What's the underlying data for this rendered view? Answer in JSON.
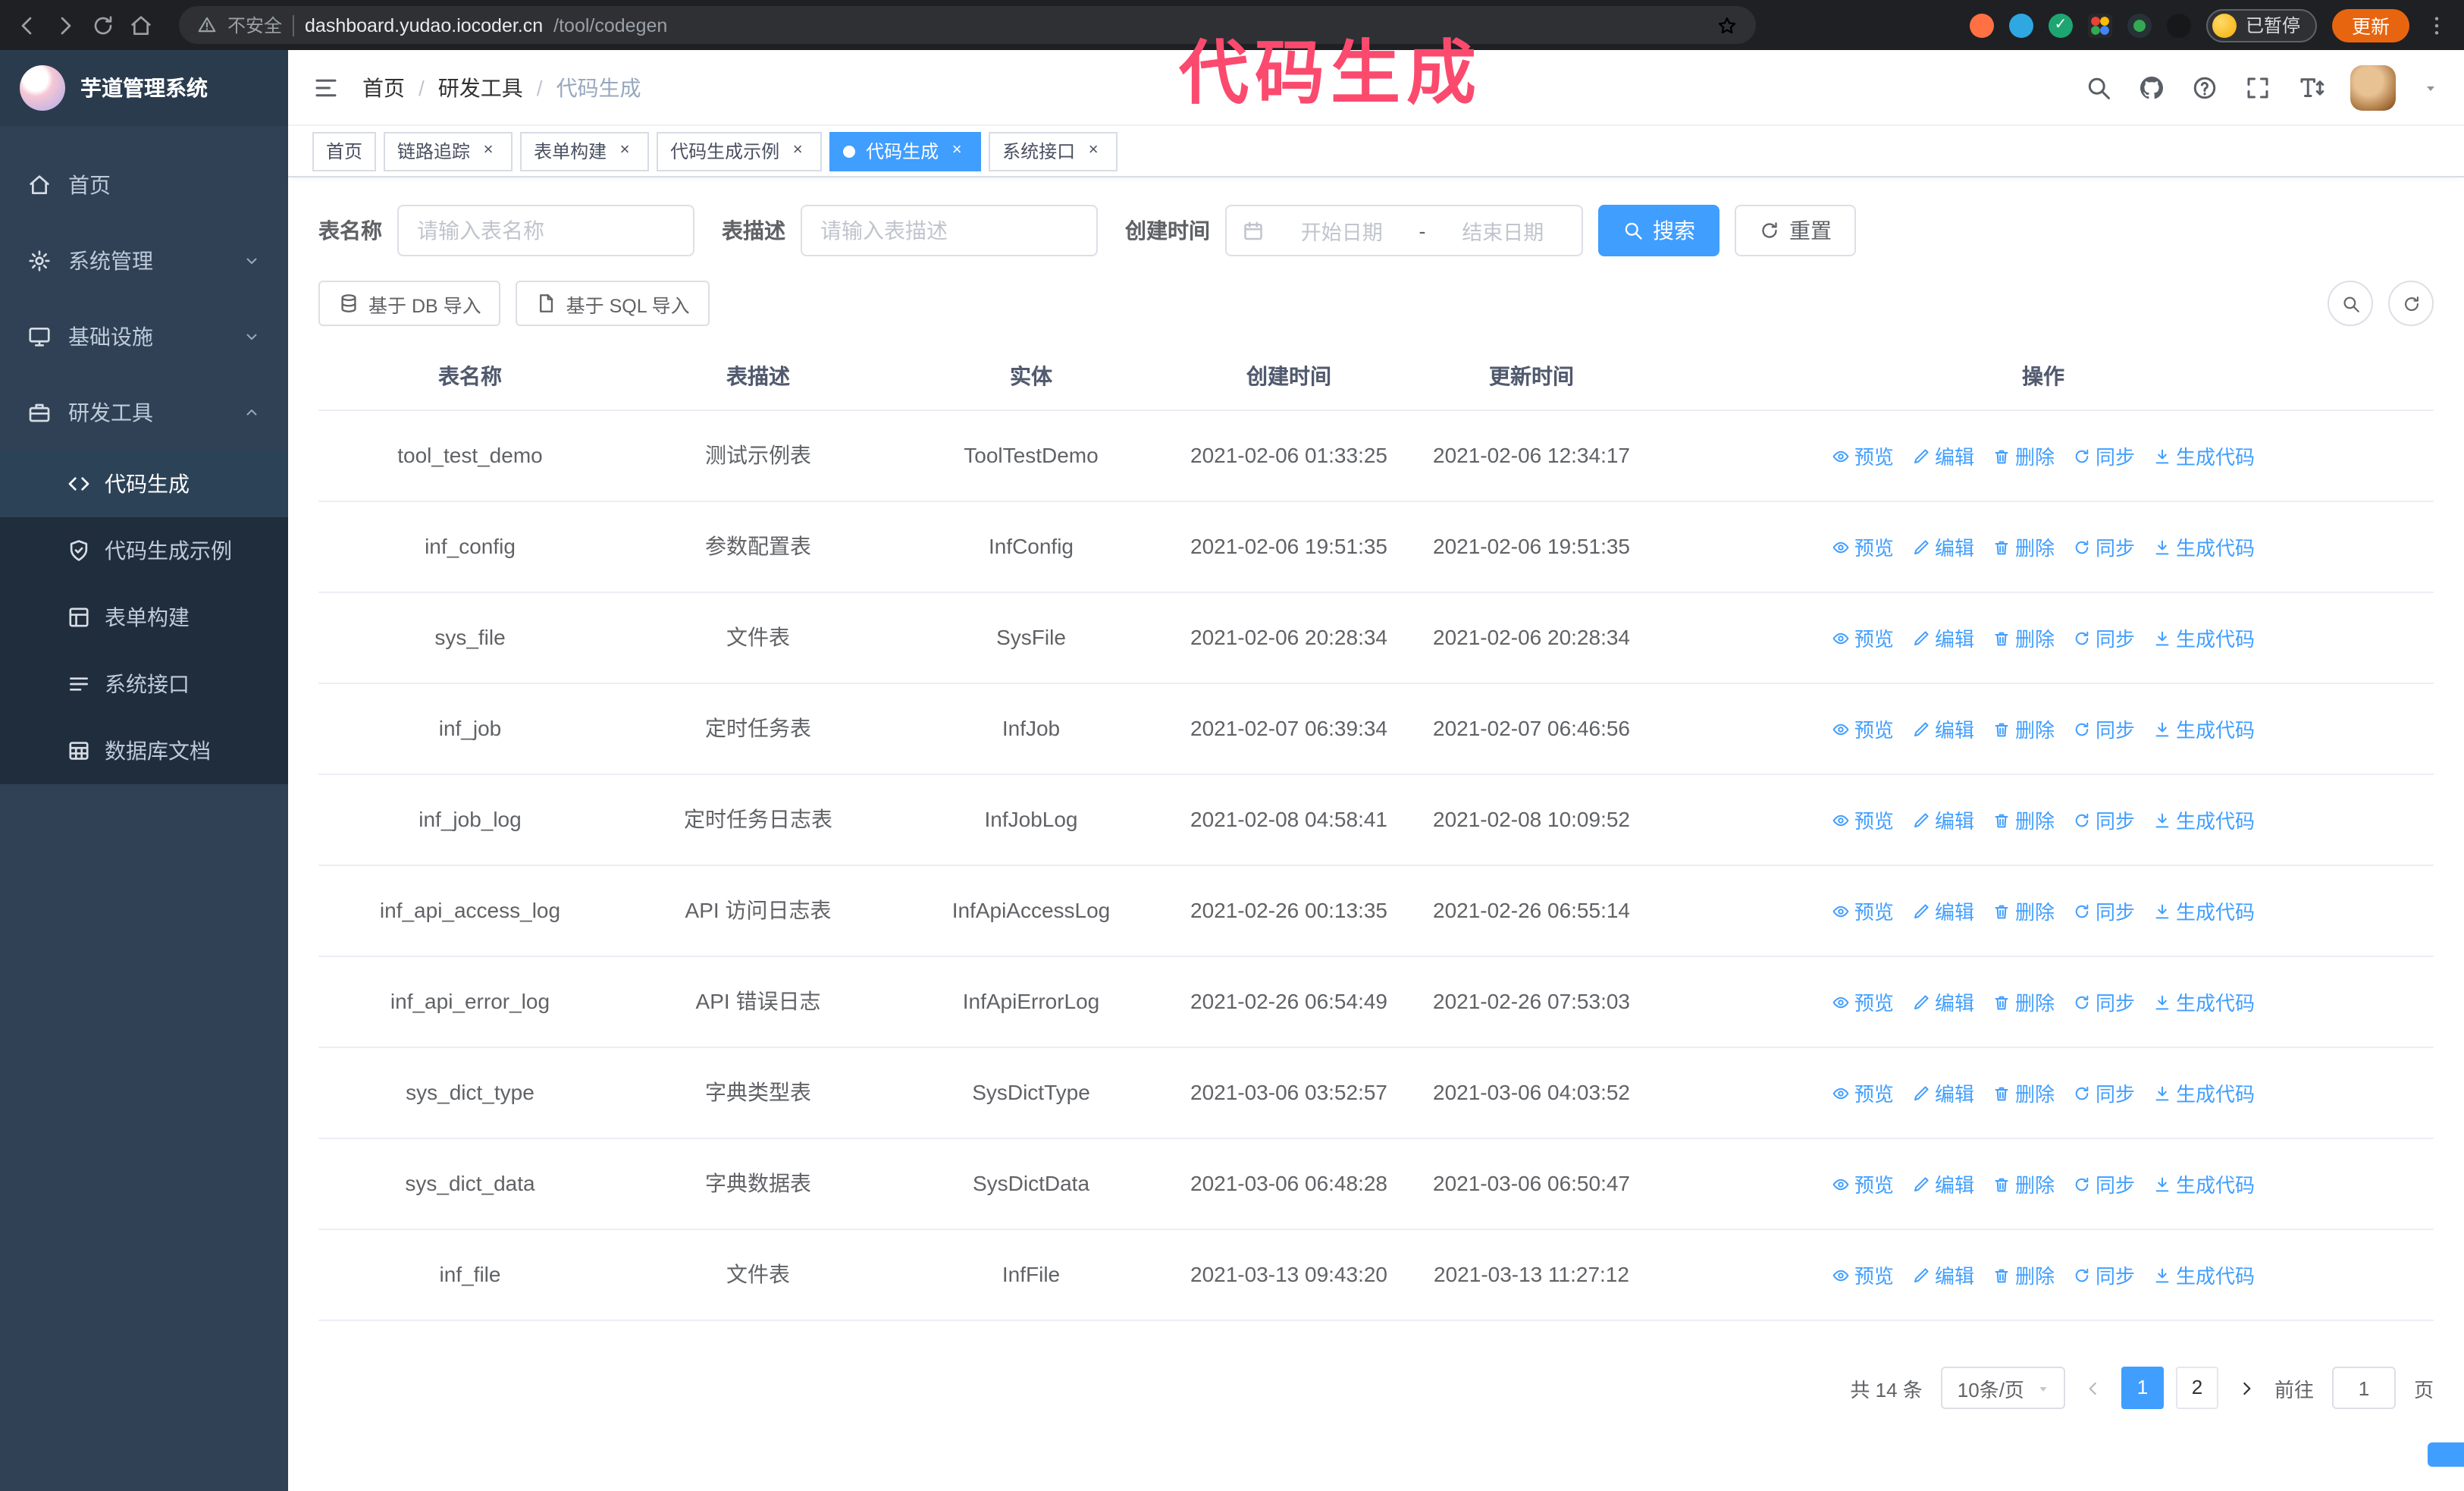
{
  "browser": {
    "security_warning": "不安全",
    "url_host": "dashboard.yudao.iocoder.cn",
    "url_path": "/tool/codegen",
    "paused_badge": "已暂停",
    "update_button": "更新"
  },
  "annotation": {
    "text": "代码生成",
    "color": "#fb4a6e"
  },
  "sidebar": {
    "logo_title": "芋道管理系统",
    "items": [
      {
        "label": "首页",
        "icon": "home5"
      },
      {
        "label": "系统管理",
        "icon": "gear",
        "expandable": true
      },
      {
        "label": "基础设施",
        "icon": "monitor",
        "expandable": true
      },
      {
        "label": "研发工具",
        "icon": "tools",
        "expandable": true,
        "expanded": true
      }
    ],
    "sub_items": [
      {
        "label": "代码生成",
        "icon": "code",
        "active": true
      },
      {
        "label": "代码生成示例",
        "icon": "shield"
      },
      {
        "label": "表单构建",
        "icon": "formgrid"
      },
      {
        "label": "系统接口",
        "icon": "api"
      },
      {
        "label": "数据库文档",
        "icon": "dbdoc"
      }
    ]
  },
  "header": {
    "breadcrumb": [
      "首页",
      "研发工具",
      "代码生成"
    ],
    "separator": "/"
  },
  "tabs": {
    "close_glyph": "×",
    "items": [
      {
        "label": "首页",
        "closable": false
      },
      {
        "label": "链路追踪",
        "closable": true
      },
      {
        "label": "表单构建",
        "closable": true
      },
      {
        "label": "代码生成示例",
        "closable": true
      },
      {
        "label": "代码生成",
        "closable": true,
        "active": true
      },
      {
        "label": "系统接口",
        "closable": true
      }
    ]
  },
  "filters": {
    "table_name_label": "表名称",
    "table_name_placeholder": "请输入表名称",
    "table_desc_label": "表描述",
    "table_desc_placeholder": "请输入表描述",
    "create_time_label": "创建时间",
    "date_start_placeholder": "开始日期",
    "date_separator": "-",
    "date_end_placeholder": "结束日期",
    "search_button": "搜索",
    "reset_button": "重置"
  },
  "toolbar": {
    "import_db": "基于 DB 导入",
    "import_sql": "基于 SQL 导入"
  },
  "table": {
    "columns": [
      "表名称",
      "表描述",
      "实体",
      "创建时间",
      "更新时间",
      "操作"
    ],
    "actions": [
      {
        "key": "preview",
        "label": "预览",
        "icon": "eye"
      },
      {
        "key": "edit",
        "label": "编辑",
        "icon": "edit"
      },
      {
        "key": "delete",
        "label": "删除",
        "icon": "del"
      },
      {
        "key": "sync",
        "label": "同步",
        "icon": "refresh"
      },
      {
        "key": "generate-code",
        "label": "生成代码",
        "icon": "download"
      }
    ],
    "rows": [
      {
        "name": "tool_test_demo",
        "desc": "测试示例表",
        "entity": "ToolTestDemo",
        "created": "2021-02-06 01:33:25",
        "updated": "2021-02-06 12:34:17"
      },
      {
        "name": "inf_config",
        "desc": "参数配置表",
        "entity": "InfConfig",
        "created": "2021-02-06 19:51:35",
        "updated": "2021-02-06 19:51:35"
      },
      {
        "name": "sys_file",
        "desc": "文件表",
        "entity": "SysFile",
        "created": "2021-02-06 20:28:34",
        "updated": "2021-02-06 20:28:34"
      },
      {
        "name": "inf_job",
        "desc": "定时任务表",
        "entity": "InfJob",
        "created": "2021-02-07 06:39:34",
        "updated": "2021-02-07 06:46:56"
      },
      {
        "name": "inf_job_log",
        "desc": "定时任务日志表",
        "entity": "InfJobLog",
        "created": "2021-02-08 04:58:41",
        "updated": "2021-02-08 10:09:52"
      },
      {
        "name": "inf_api_access_log",
        "desc": "API 访问日志表",
        "entity": "InfApiAccessLog",
        "created": "2021-02-26 00:13:35",
        "updated": "2021-02-26 06:55:14"
      },
      {
        "name": "inf_api_error_log",
        "desc": "API 错误日志",
        "entity": "InfApiErrorLog",
        "created": "2021-02-26 06:54:49",
        "updated": "2021-02-26 07:53:03"
      },
      {
        "name": "sys_dict_type",
        "desc": "字典类型表",
        "entity": "SysDictType",
        "created": "2021-03-06 03:52:57",
        "updated": "2021-03-06 04:03:52"
      },
      {
        "name": "sys_dict_data",
        "desc": "字典数据表",
        "entity": "SysDictData",
        "created": "2021-03-06 06:48:28",
        "updated": "2021-03-06 06:50:47"
      },
      {
        "name": "inf_file",
        "desc": "文件表",
        "entity": "InfFile",
        "created": "2021-03-13 09:43:20",
        "updated": "2021-03-13 11:27:12"
      }
    ]
  },
  "pagination": {
    "total": "共 14 条",
    "page_size": "10条/页",
    "pages": [
      "1",
      "2"
    ],
    "active_page": "1",
    "goto_label": "前往",
    "goto_value": "1",
    "goto_suffix": "页"
  },
  "colors": {
    "accent": "#409eff",
    "sidebar_bg": "#304156",
    "annotation": "#fb4a6e"
  }
}
